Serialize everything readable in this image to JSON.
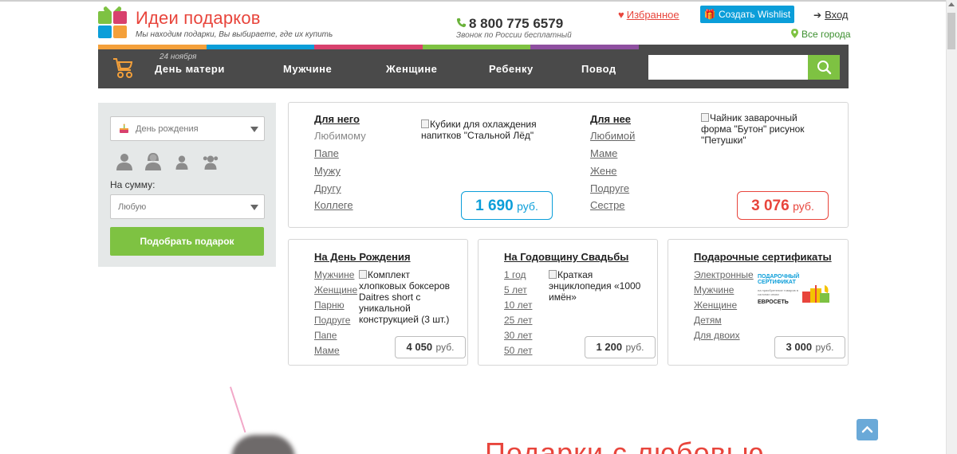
{
  "header": {
    "logo_title": "Идеи подарков",
    "logo_subtitle": "Мы находим подарки, Вы выбираете, где их купить",
    "phone": "8 800 775 6579",
    "phone_note": "Звонок по России бесплатный",
    "favorites": "Избранное",
    "wishlist_button": "Создать Wishlist",
    "login": "Вход",
    "city": "Все города"
  },
  "nav": {
    "promo_date": "24 ноября",
    "items": [
      "День матери",
      "Мужчине",
      "Женщине",
      "Ребенку",
      "Повод"
    ],
    "search_placeholder": ""
  },
  "filter": {
    "occasion_value": "День рождения",
    "sum_label": "На сумму:",
    "sum_value": "Любую",
    "submit": "Подобрать подарок"
  },
  "cards": {
    "for_him": {
      "title": "Для него",
      "links": [
        "Любимому",
        "Папе",
        "Мужу",
        "Другу",
        "Коллеге"
      ],
      "product_alt": "Кубики для охлаждения напитков \"Стальной Лёд\"",
      "price": "1 690",
      "currency": "руб."
    },
    "for_her": {
      "title": "Для нее",
      "links": [
        "Любимой",
        "Маме",
        "Жене",
        "Подруге",
        "Сестре"
      ],
      "product_alt": "Чайник заварочный форма \"Бутон\" рисунок \"Петушки\"",
      "price": "3 076",
      "currency": "руб."
    },
    "birthday": {
      "title": "На День Рождения",
      "links": [
        "Мужчине",
        "Женщине",
        "Парню",
        "Подруге",
        "Папе",
        "Маме"
      ],
      "product_alt": "Комплект хлопковых боксеров Daitres short с уникальной конструкцией (3 шт.)",
      "price": "4 050",
      "currency": "руб."
    },
    "anniversary": {
      "title": "На Годовщину Свадьбы",
      "links": [
        "1 год",
        "5 лет",
        "10 лет",
        "25 лет",
        "30 лет",
        "50 лет"
      ],
      "product_alt": "Краткая энциклопедия «1000 имён»",
      "price": "1 200",
      "currency": "руб."
    },
    "certificates": {
      "title": "Подарочные сертификаты",
      "links": [
        "Электронные",
        "Мужчине",
        "Женщине",
        "Детям",
        "Для двоих"
      ],
      "cert_title": "ПОДАРОЧНЫЙ СЕРТИФИКАТ",
      "cert_small": "на приобретение товаров в салонах связи",
      "cert_brand": "ЕВРОСЕТЬ",
      "price": "3 000",
      "currency": "руб."
    }
  },
  "banner": {
    "text": "Подарки с любовью"
  },
  "colors": {
    "accent_red": "#e8453c",
    "accent_green": "#7ec242",
    "accent_blue": "#0b9ed9",
    "nav_bg": "#4a4a4a",
    "strip": [
      "#f4a03a",
      "#0b9ed9",
      "#d8416d",
      "#7ec242",
      "#8e4fa0"
    ]
  }
}
